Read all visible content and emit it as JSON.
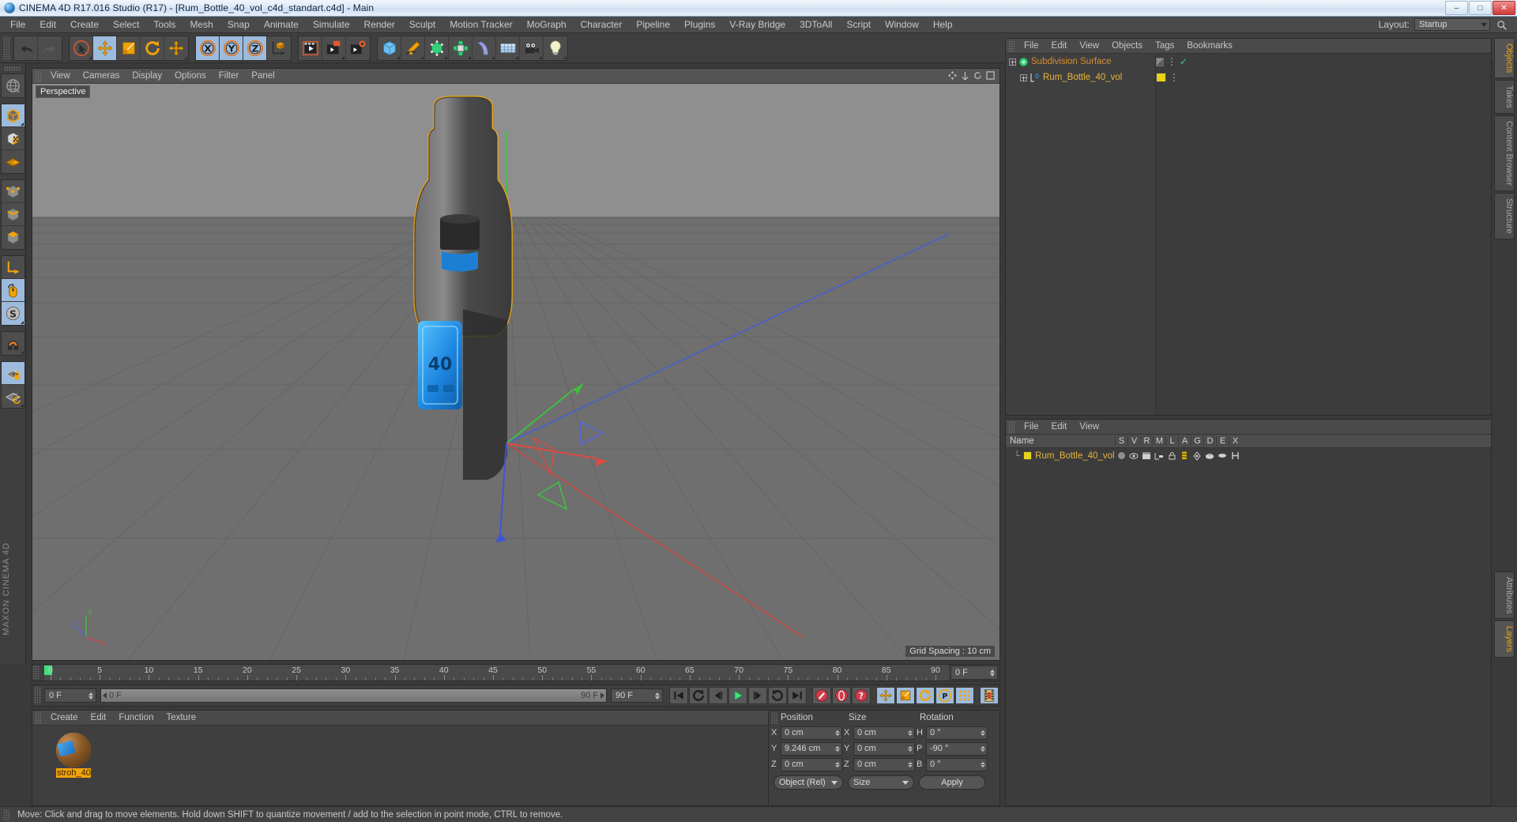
{
  "window": {
    "title": "CINEMA 4D R17.016 Studio (R17) - [Rum_Bottle_40_vol_c4d_standart.c4d] - Main",
    "app_icon": "cinema4d-icon",
    "minimize": "–",
    "maximize": "□",
    "close": "✕"
  },
  "menubar": {
    "items": [
      "File",
      "Edit",
      "Create",
      "Select",
      "Tools",
      "Mesh",
      "Snap",
      "Animate",
      "Simulate",
      "Render",
      "Sculpt",
      "Motion Tracker",
      "MoGraph",
      "Character",
      "Pipeline",
      "Plugins",
      "V-Ray Bridge",
      "3DToAll",
      "Script",
      "Window",
      "Help"
    ],
    "layout_label": "Layout:",
    "layout_value": "Startup",
    "search_icon": "search-icon"
  },
  "toolbar": {
    "groups": [
      {
        "name": "history",
        "buttons": [
          {
            "name": "undo-button",
            "icon": "undo-icon",
            "active": false,
            "corner": false
          },
          {
            "name": "redo-button",
            "icon": "redo-icon",
            "active": false,
            "corner": false,
            "dim": true
          }
        ]
      },
      {
        "name": "transform",
        "buttons": [
          {
            "name": "live-selection-button",
            "icon": "cursor-select-icon",
            "active": false,
            "corner": true
          },
          {
            "name": "move-tool-button",
            "icon": "move-icon",
            "active": true,
            "corner": false
          },
          {
            "name": "scale-tool-button",
            "icon": "scale-icon",
            "active": false,
            "corner": false
          },
          {
            "name": "rotate-tool-button",
            "icon": "rotate-icon",
            "active": false,
            "corner": false
          },
          {
            "name": "free-move-button",
            "icon": "move-free-icon",
            "active": false,
            "corner": true
          }
        ]
      },
      {
        "name": "axis-lock",
        "buttons": [
          {
            "name": "lock-x-button",
            "icon": "axis-x-icon",
            "active": true,
            "corner": false
          },
          {
            "name": "lock-y-button",
            "icon": "axis-y-icon",
            "active": true,
            "corner": false
          },
          {
            "name": "lock-z-button",
            "icon": "axis-z-icon",
            "active": true,
            "corner": false
          },
          {
            "name": "world-coordinates-button",
            "icon": "world-axis-icon",
            "active": false,
            "corner": false
          }
        ]
      },
      {
        "name": "render",
        "buttons": [
          {
            "name": "render-view-button",
            "icon": "render-view-icon",
            "active": false,
            "corner": false
          },
          {
            "name": "render-region-button",
            "icon": "render-region-icon",
            "active": false,
            "corner": true
          },
          {
            "name": "render-settings-button",
            "icon": "render-settings-icon",
            "active": false,
            "corner": false
          }
        ]
      },
      {
        "name": "create",
        "buttons": [
          {
            "name": "add-cube-button",
            "icon": "cube-icon",
            "active": false,
            "corner": true
          },
          {
            "name": "add-spline-button",
            "icon": "pen-spline-icon",
            "active": false,
            "corner": true
          },
          {
            "name": "add-generator-button",
            "icon": "generator-icon",
            "active": false,
            "corner": true
          },
          {
            "name": "add-deformer-button",
            "icon": "deformer-icon",
            "active": false,
            "corner": true
          },
          {
            "name": "add-scene-button",
            "icon": "bend-icon",
            "active": false,
            "corner": true
          },
          {
            "name": "add-environment-button",
            "icon": "floor-icon",
            "active": false,
            "corner": true
          },
          {
            "name": "add-camera-button",
            "icon": "camera-icon",
            "active": false,
            "corner": true
          },
          {
            "name": "add-light-button",
            "icon": "light-bulb-icon",
            "active": false,
            "corner": true
          }
        ]
      }
    ]
  },
  "left_toolbar": {
    "brand": "MAXON CINEMA 4D",
    "groups": [
      {
        "buttons": [
          {
            "name": "make-editable-button",
            "icon": "globe-editable-icon",
            "active": false,
            "corner": false
          }
        ]
      },
      {
        "buttons": [
          {
            "name": "model-mode-button",
            "icon": "model-cube-icon",
            "active": true,
            "corner": true
          },
          {
            "name": "texture-mode-button",
            "icon": "texture-cube-icon",
            "active": false,
            "corner": false
          },
          {
            "name": "workplane-mode-button",
            "icon": "workplane-icon",
            "active": false,
            "corner": false
          }
        ]
      },
      {
        "buttons": [
          {
            "name": "points-mode-button",
            "icon": "points-icon",
            "active": false,
            "corner": false
          },
          {
            "name": "edges-mode-button",
            "icon": "edges-icon",
            "active": false,
            "corner": false
          },
          {
            "name": "polygons-mode-button",
            "icon": "polygons-icon",
            "active": false,
            "corner": false
          }
        ]
      },
      {
        "buttons": [
          {
            "name": "object-axis-button",
            "icon": "axis-corner-icon",
            "active": false,
            "corner": false
          },
          {
            "name": "viewport-solo-button",
            "icon": "mouse-icon",
            "active": true,
            "corner": false
          },
          {
            "name": "soft-selection-button",
            "icon": "s-circle-icon",
            "active": true,
            "corner": true
          }
        ]
      },
      {
        "buttons": [
          {
            "name": "snap-magnet-button",
            "icon": "magnet-icon",
            "active": false,
            "corner": true
          }
        ]
      },
      {
        "buttons": [
          {
            "name": "lock-workplane-button",
            "icon": "grid-lock-icon",
            "active": true,
            "corner": false
          },
          {
            "name": "workplane-rotate-button",
            "icon": "grid-rotate-icon",
            "active": false,
            "corner": true
          }
        ]
      }
    ]
  },
  "viewport": {
    "menus": [
      "View",
      "Cameras",
      "Display",
      "Options",
      "Filter",
      "Panel"
    ],
    "label": "Perspective",
    "grid_spacing": "Grid Spacing : 10 cm",
    "axis_labels": {
      "x": "X",
      "y": "Y",
      "z": "Z"
    },
    "colors": {
      "bg_top": "#8d8d8d",
      "bg_bottom": "#585858",
      "axis_x": "#d04a4a",
      "axis_y": "#4fc04f",
      "axis_z": "#4a5ed0",
      "bottle_body": "#5a5a5a",
      "label_blue": "#2196f3",
      "selection_outline": "#f0a30a"
    },
    "bottle_label_text": "40"
  },
  "timeline": {
    "ticks": [
      0,
      5,
      10,
      15,
      20,
      25,
      30,
      35,
      40,
      45,
      50,
      55,
      60,
      65,
      70,
      75,
      80,
      85,
      90
    ],
    "current_frame": "0 F",
    "current_frame_field": "0 F",
    "track_start": "0 F",
    "track_end": "90 F",
    "end_frame": "90 F",
    "preview_frame": "0 F"
  },
  "transport": {
    "buttons": [
      {
        "name": "go-to-start-button",
        "icon": "skip-start-icon"
      },
      {
        "name": "previous-keyframe-button",
        "icon": "prev-key-icon"
      },
      {
        "name": "step-back-button",
        "icon": "step-back-icon"
      },
      {
        "name": "play-button",
        "icon": "play-icon"
      },
      {
        "name": "step-forward-button",
        "icon": "step-forward-icon"
      },
      {
        "name": "next-keyframe-button",
        "icon": "next-key-icon"
      },
      {
        "name": "go-to-end-button",
        "icon": "skip-end-icon"
      },
      {
        "name": "record-active-objects-button",
        "icon": "record-icon"
      },
      {
        "name": "autokeying-button",
        "icon": "autokey-icon"
      },
      {
        "name": "keyframe-selection-button",
        "icon": "key-question-icon"
      },
      {
        "name": "record-position-button",
        "icon": "pos-move-icon"
      },
      {
        "name": "record-scale-button",
        "icon": "scale-key-icon"
      },
      {
        "name": "record-rotation-button",
        "icon": "rot-key-icon"
      },
      {
        "name": "record-parameter-button",
        "icon": "param-p-icon"
      },
      {
        "name": "record-pla-button",
        "icon": "pla-dots-icon"
      },
      {
        "name": "timeline-button",
        "icon": "filmstrip-icon"
      }
    ]
  },
  "material_manager": {
    "menus": [
      "Create",
      "Edit",
      "Function",
      "Texture"
    ],
    "materials": [
      {
        "name": "stroh_40",
        "selected": true
      }
    ]
  },
  "coordinates": {
    "columns": [
      "Position",
      "Size",
      "Rotation"
    ],
    "rows": [
      {
        "pos_axis": "X",
        "pos_value": "0 cm",
        "size_axis": "X",
        "size_value": "0 cm",
        "rot_axis": "H",
        "rot_value": "0 °"
      },
      {
        "pos_axis": "Y",
        "pos_value": "9.246 cm",
        "size_axis": "Y",
        "size_value": "0 cm",
        "rot_axis": "P",
        "rot_value": "-90 °"
      },
      {
        "pos_axis": "Z",
        "pos_value": "0 cm",
        "size_axis": "Z",
        "size_value": "0 cm",
        "rot_axis": "B",
        "rot_value": "0 °"
      }
    ],
    "mode_dropdown": "Object (Rel)",
    "size_dropdown": "Size",
    "apply_label": "Apply"
  },
  "object_manager": {
    "menus": [
      "File",
      "Edit",
      "View",
      "Objects",
      "Tags",
      "Bookmarks"
    ],
    "items": [
      {
        "name": "Subdivision Surface",
        "type": "generator",
        "indent": 0,
        "selected": false,
        "tag_check": true
      },
      {
        "name": "Rum_Bottle_40_vol",
        "type": "polygon",
        "indent": 1,
        "selected": false,
        "tag_color": "#e8d318"
      }
    ]
  },
  "layer_manager": {
    "menus": [
      "File",
      "Edit",
      "View"
    ],
    "columns": [
      "Name",
      "S",
      "V",
      "R",
      "M",
      "L",
      "A",
      "G",
      "D",
      "E",
      "X"
    ],
    "rows": [
      {
        "name": "Rum_Bottle_40_vol",
        "color": "#e8d318"
      }
    ]
  },
  "side_tabs": {
    "top": [
      {
        "label": "Objects",
        "active": true
      },
      {
        "label": "Takes",
        "active": false
      },
      {
        "label": "Content Browser",
        "active": false
      },
      {
        "label": "Structure",
        "active": false
      }
    ],
    "bottom": [
      {
        "label": "Attributes",
        "active": false
      },
      {
        "label": "Layers",
        "active": true
      }
    ]
  },
  "statusbar": {
    "message": "Move: Click and drag to move elements. Hold down SHIFT to quantize movement / add to the selection in point mode, CTRL to remove."
  }
}
